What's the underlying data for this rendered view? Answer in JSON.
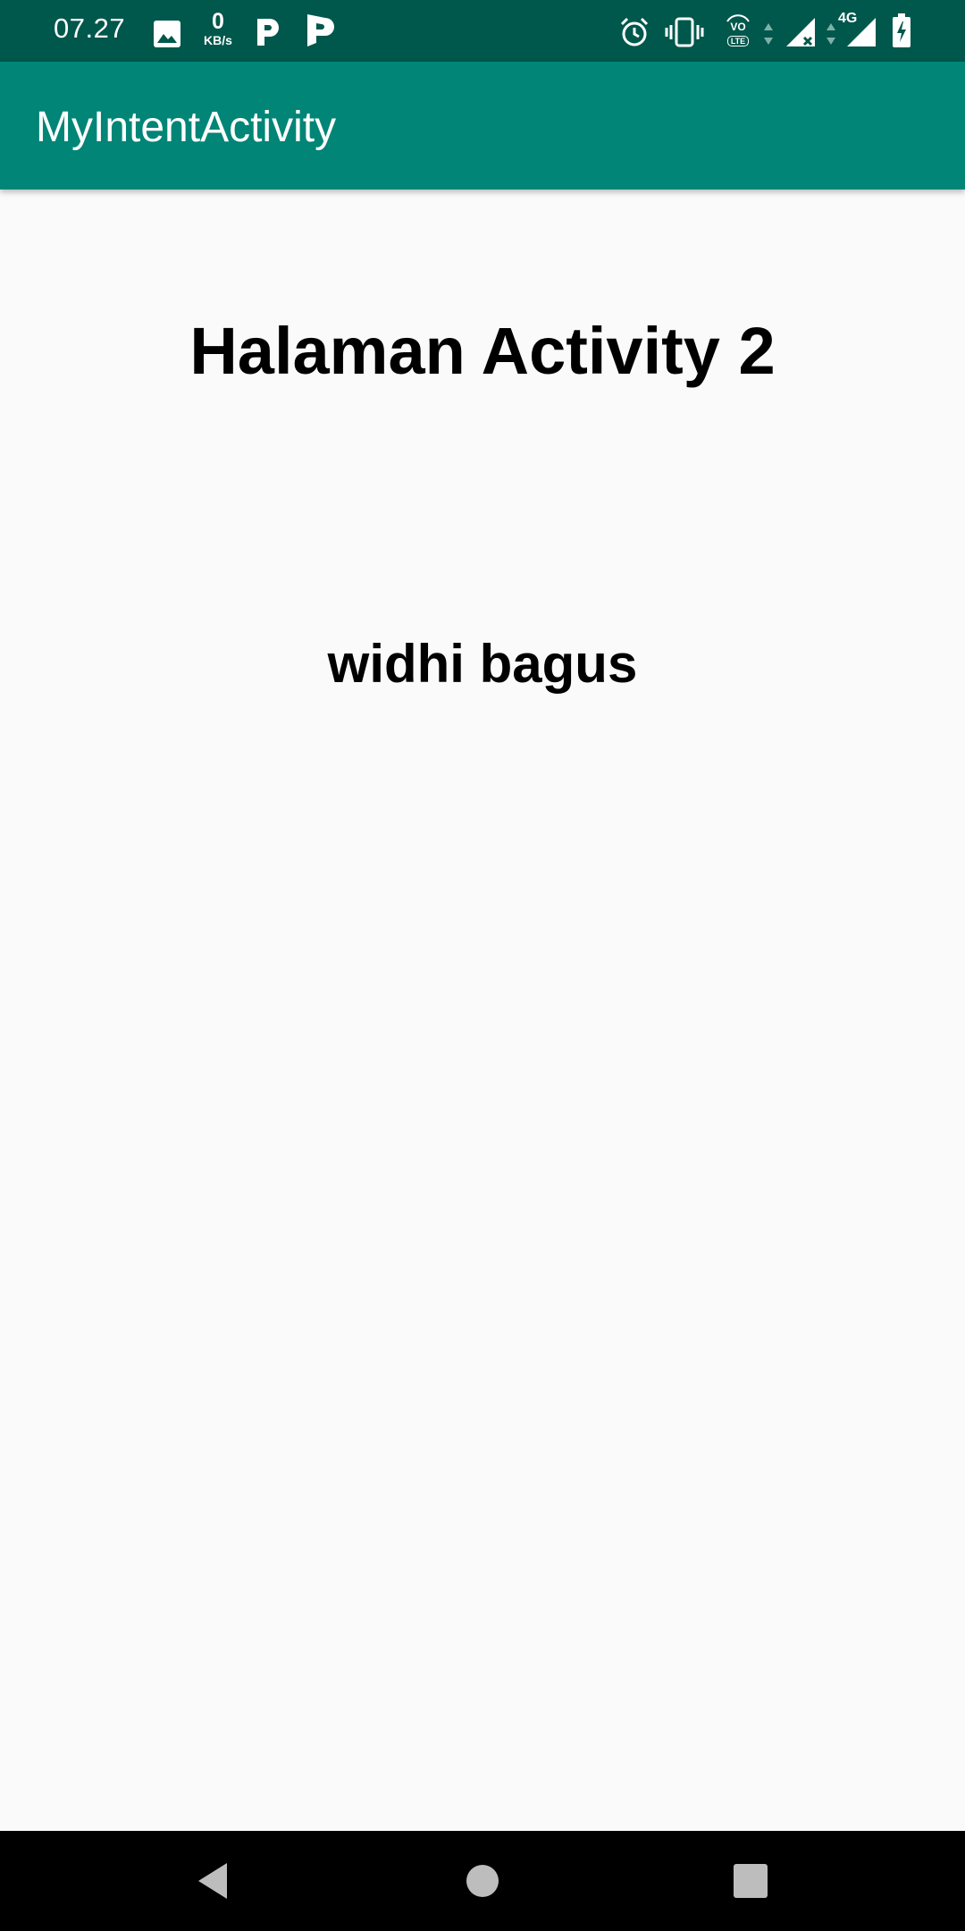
{
  "status_bar": {
    "time": "07.27",
    "network_speed_value": "0",
    "network_speed_unit": "KB/s",
    "volte_label": "VO",
    "lte_label": "LTE",
    "network_type": "4G",
    "icons": [
      "image-icon",
      "parking-icon",
      "parking-flag-icon",
      "alarm-icon",
      "vibrate-icon",
      "volte-icon",
      "signal-icon",
      "signal-no-data-icon",
      "battery-charging-icon"
    ]
  },
  "app_bar": {
    "title": "MyIntentActivity",
    "color": "#008577",
    "status_color": "#00574b"
  },
  "content": {
    "heading": "Halaman Activity 2",
    "received_name": "widhi bagus"
  },
  "nav_bar": {
    "buttons": [
      "back-icon",
      "home-icon",
      "recents-icon"
    ]
  }
}
